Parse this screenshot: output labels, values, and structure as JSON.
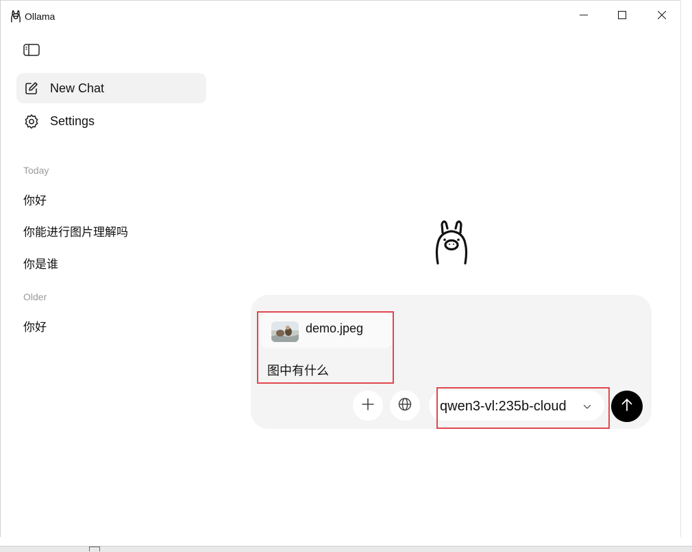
{
  "window": {
    "title": "Ollama",
    "icons": {
      "logo": "ollama-llama-icon",
      "minimize": "minimize-icon",
      "maximize": "maximize-icon",
      "close": "close-icon"
    }
  },
  "sidebar": {
    "toggle_icon": "sidebar-toggle-icon",
    "new_chat": {
      "label": "New Chat",
      "icon": "compose-icon"
    },
    "settings": {
      "label": "Settings",
      "icon": "gear-icon"
    },
    "sections": [
      {
        "label": "Today",
        "items": [
          "你好",
          "你能进行图片理解吗",
          "你是谁"
        ]
      },
      {
        "label": "Older",
        "items": [
          "你好"
        ]
      }
    ]
  },
  "composer": {
    "attachment": {
      "file_name": "demo.jpeg",
      "thumbnail": "image-thumbnail"
    },
    "prompt_text": "图中有什么",
    "add_icon": "plus-icon",
    "web_icon": "globe-icon",
    "model": {
      "selected": "qwen3-vl:235b-cloud",
      "icon": "chevron-down-icon"
    },
    "send_icon": "arrow-up-icon"
  },
  "colors": {
    "highlight_box": "#e0474c",
    "active_nav_bg": "#f2f2f2",
    "composer_bg": "#f4f4f4",
    "send_button": "#000000",
    "section_label": "#9a9a9a"
  }
}
